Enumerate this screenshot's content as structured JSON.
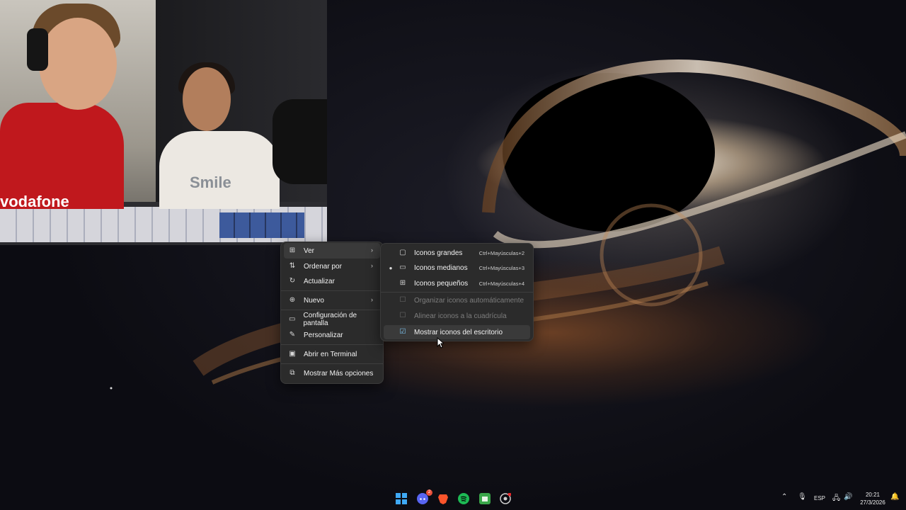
{
  "webcam": {
    "shirt_text": "vodafone",
    "tee_text": "Smile"
  },
  "context_menu": {
    "items": [
      {
        "label": "Ver",
        "icon": "view-grid-icon",
        "has_submenu": true
      },
      {
        "label": "Ordenar por",
        "icon": "sort-icon",
        "has_submenu": true
      },
      {
        "label": "Actualizar",
        "icon": "refresh-icon",
        "has_submenu": false
      },
      {
        "label": "Nuevo",
        "icon": "add-circle-icon",
        "has_submenu": true
      },
      {
        "label": "Configuración de pantalla",
        "icon": "display-settings-icon",
        "has_submenu": false
      },
      {
        "label": "Personalizar",
        "icon": "brush-icon",
        "has_submenu": false
      },
      {
        "label": "Abrir en Terminal",
        "icon": "terminal-icon",
        "has_submenu": false
      },
      {
        "label": "Mostrar Más opciones",
        "icon": "more-options-icon",
        "has_submenu": false
      }
    ]
  },
  "view_submenu": {
    "items": [
      {
        "label": "Iconos grandes",
        "shortcut": "Ctrl+Mayúsculas+2",
        "icon": "monitor-icon",
        "selected": false,
        "disabled": false
      },
      {
        "label": "Iconos medianos",
        "shortcut": "Ctrl+Mayúsculas+3",
        "icon": "monitor-small-icon",
        "selected": true,
        "disabled": false
      },
      {
        "label": "Iconos pequeños",
        "shortcut": "Ctrl+Mayúsculas+4",
        "icon": "grid-icon",
        "selected": false,
        "disabled": false
      },
      {
        "label": "Organizar iconos automáticamente",
        "shortcut": "",
        "icon": "checkbox-icon",
        "selected": false,
        "disabled": true
      },
      {
        "label": "Alinear iconos a la cuadrícula",
        "shortcut": "",
        "icon": "checkbox-icon",
        "selected": false,
        "disabled": true
      },
      {
        "label": "Mostrar iconos del escritorio",
        "shortcut": "",
        "icon": "checkbox-checked-icon",
        "selected": false,
        "disabled": false
      }
    ]
  },
  "taskbar": {
    "apps": [
      {
        "name": "start-button",
        "icon": "windows-logo-icon",
        "color": "#3fa9f5"
      },
      {
        "name": "discord",
        "icon": "discord-icon",
        "color": "#5865f2",
        "badge": "2"
      },
      {
        "name": "brave",
        "icon": "brave-icon",
        "color": "#fb542b"
      },
      {
        "name": "spotify",
        "icon": "spotify-icon",
        "color": "#1db954"
      },
      {
        "name": "app-green",
        "icon": "app-icon",
        "color": "#3aa64a"
      },
      {
        "name": "obs",
        "icon": "record-icon",
        "color": "#cfcfcf"
      }
    ],
    "tray": {
      "language": "ESP",
      "time": "20:21",
      "date": "27/3/2026"
    }
  }
}
